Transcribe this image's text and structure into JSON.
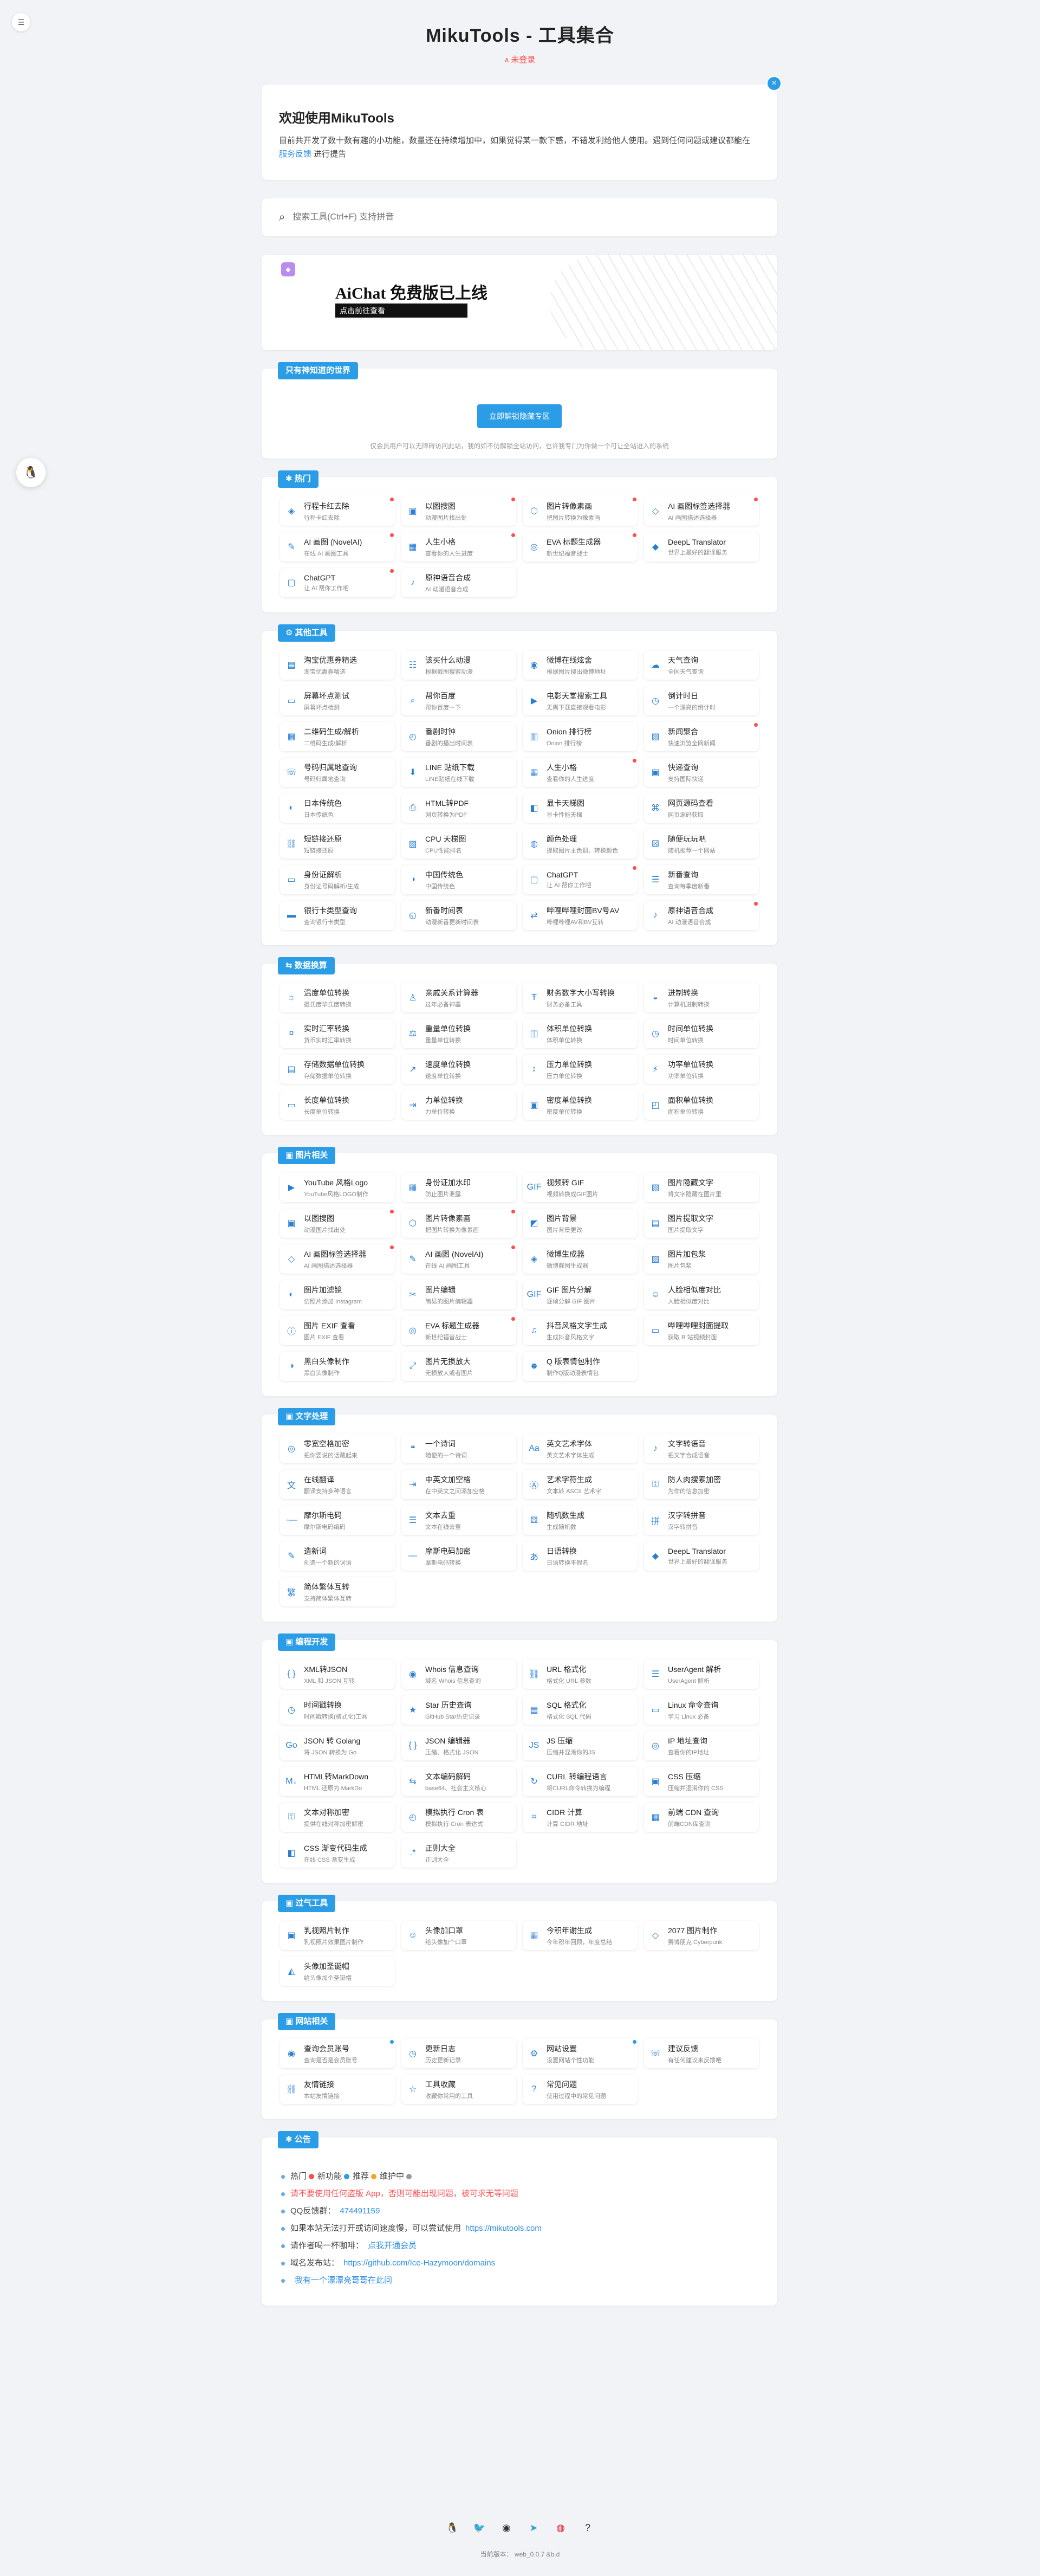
{
  "page": {
    "title": "MikuTools - 工具集合",
    "login": "ᴀ 未登录"
  },
  "welcome": {
    "heading": "欢迎使用MikuTools",
    "text": "目前共开发了数十数有趣的小功能，数量还在持续增加中，如果觉得某一款下感，不错发利给他人使用。遇到任何问题或建议都能在 ",
    "link": "服务反馈",
    "tail": " 进行提告"
  },
  "search": {
    "placeholder": "搜索工具(Ctrl+F) 支持拼音"
  },
  "banner": {
    "title": "AiChat 免费版已上线",
    "button": "点击前往查看"
  },
  "secret": {
    "title": "只有神知道的世界",
    "button": "立即解锁隐藏专区",
    "note": "仅会员用户可以无障碍访问此站，我的如不仿解锁全站访问，也许我专门为你做一个可让全站进入的系统"
  },
  "colors": {
    "accent": "#2b9de6",
    "hot": "#ff4d4f",
    "new": "#2b9de6",
    "rec": "#f5a623",
    "maint": "#999999"
  },
  "sections": [
    {
      "title": "✱ 热门",
      "tools": [
        {
          "name": "行程卡红去除",
          "desc": "行程卡红去除",
          "icon": "◈",
          "dot": "#ff4d4f"
        },
        {
          "name": "以图搜图",
          "desc": "动漫图片找出处",
          "icon": "▣",
          "dot": "#ff4d4f"
        },
        {
          "name": "图片转像素画",
          "desc": "把图片转换为像素画",
          "icon": "⬡",
          "dot": "#ff4d4f"
        },
        {
          "name": "AI 画图标签选择器",
          "desc": "AI 画图描述选择器",
          "icon": "◇",
          "dot": "#ff4d4f"
        },
        {
          "name": "AI 画图 (NovelAI)",
          "desc": "在线 AI 画图工具",
          "icon": "✎",
          "dot": "#ff4d4f"
        },
        {
          "name": "人生小格",
          "desc": "查看你的人生进度",
          "icon": "▦",
          "dot": "#ff4d4f"
        },
        {
          "name": "EVA 标题生成器",
          "desc": "新世纪福音战士",
          "icon": "◎",
          "dot": "#ff4d4f"
        },
        {
          "name": "DeepL Translator",
          "desc": "世界上最好的翻译服务",
          "icon": "◆",
          "dot": ""
        },
        {
          "name": "ChatGPT",
          "desc": "让 AI 帮你工作吧",
          "icon": "▢",
          "dot": "#ff4d4f"
        },
        {
          "name": "原神语音合成",
          "desc": "AI 动漫语音合成",
          "icon": "♪",
          "dot": ""
        }
      ]
    },
    {
      "title": "⚙ 其他工具",
      "tools": [
        {
          "name": "淘宝优惠券精选",
          "desc": "淘宝优惠券精选",
          "icon": "▤",
          "dot": ""
        },
        {
          "name": "该买什么动漫",
          "desc": "根据截图搜索动漫",
          "icon": "☷",
          "dot": ""
        },
        {
          "name": "微博在线炫舍",
          "desc": "根据图片搜出微博地址",
          "icon": "◉",
          "dot": ""
        },
        {
          "name": "天气查询",
          "desc": "全国天气查询",
          "icon": "☁",
          "dot": ""
        },
        {
          "name": "屏幕坏点测试",
          "desc": "屏幕坏点检测",
          "icon": "▭",
          "dot": ""
        },
        {
          "name": "帮你百度",
          "desc": "帮你百度一下",
          "icon": "⌕",
          "dot": ""
        },
        {
          "name": "电影天堂搜索工具",
          "desc": "无需下载直接观看电影",
          "icon": "▶",
          "dot": ""
        },
        {
          "name": "倒计时日",
          "desc": "一个漂亮的倒计时",
          "icon": "◷",
          "dot": ""
        },
        {
          "name": "二维码生成/解析",
          "desc": "二维码生成/解析",
          "icon": "▦",
          "dot": ""
        },
        {
          "name": "番剧时钟",
          "desc": "番剧的播出时间表",
          "icon": "◴",
          "dot": ""
        },
        {
          "name": "Onion 排行榜",
          "desc": "Onion 排行榜",
          "icon": "▥",
          "dot": ""
        },
        {
          "name": "新闻聚合",
          "desc": "快速浏览全网新闻",
          "icon": "▧",
          "dot": "#ff4d4f"
        },
        {
          "name": "号码归属地查询",
          "desc": "号码归属地查询",
          "icon": "☏",
          "dot": ""
        },
        {
          "name": "LINE 贴纸下载",
          "desc": "LINE贴纸在线下载",
          "icon": "⬇",
          "dot": ""
        },
        {
          "name": "人生小格",
          "desc": "查看你的人生进度",
          "icon": "▦",
          "dot": "#ff4d4f"
        },
        {
          "name": "快递查询",
          "desc": "支持国际快递",
          "icon": "▣",
          "dot": ""
        },
        {
          "name": "日本传统色",
          "desc": "日本传统色",
          "icon": "◐",
          "dot": ""
        },
        {
          "name": "HTML转PDF",
          "desc": "网页转换为PDF",
          "icon": "⎙",
          "dot": ""
        },
        {
          "name": "显卡天梯图",
          "desc": "显卡性能天梯",
          "icon": "◧",
          "dot": ""
        },
        {
          "name": "网页源码查看",
          "desc": "网页源码获取",
          "icon": "⌘",
          "dot": ""
        },
        {
          "name": "短链接还原",
          "desc": "短链接还原",
          "icon": "⛓",
          "dot": ""
        },
        {
          "name": "CPU 天梯图",
          "desc": "CPU性能排名",
          "icon": "▨",
          "dot": ""
        },
        {
          "name": "颜色处理",
          "desc": "提取图片主色调、转换颜色",
          "icon": "◍",
          "dot": ""
        },
        {
          "name": "随便玩玩吧",
          "desc": "随机推荐一个网站",
          "icon": "⚄",
          "dot": ""
        },
        {
          "name": "身份证解析",
          "desc": "身份证号码解析/生成",
          "icon": "▭",
          "dot": ""
        },
        {
          "name": "中国传统色",
          "desc": "中国传统色",
          "icon": "◑",
          "dot": ""
        },
        {
          "name": "ChatGPT",
          "desc": "让 AI 帮你工作吧",
          "icon": "▢",
          "dot": "#ff4d4f"
        },
        {
          "name": "新番查询",
          "desc": "查询每季度新番",
          "icon": "☰",
          "dot": ""
        },
        {
          "name": "银行卡类型查询",
          "desc": "查询银行卡类型",
          "icon": "▬",
          "dot": ""
        },
        {
          "name": "新番时间表",
          "desc": "动漫新番更新时间表",
          "icon": "◵",
          "dot": ""
        },
        {
          "name": "哔哩哔哩封面BV号AV",
          "desc": "哔哩哔哩AV和BV互转",
          "icon": "⇄",
          "dot": ""
        },
        {
          "name": "原神语音合成",
          "desc": "AI 动漫语音合成",
          "icon": "♪",
          "dot": "#ff4d4f"
        }
      ]
    },
    {
      "title": "⇆ 数据换算",
      "tools": [
        {
          "name": "温度单位转换",
          "desc": "摄氏度华氏度转换",
          "icon": "☼",
          "dot": ""
        },
        {
          "name": "亲戚关系计算器",
          "desc": "过年必备神器",
          "icon": "♙",
          "dot": ""
        },
        {
          "name": "财务数字大小写转换",
          "desc": "财务必备工具",
          "icon": "Ŧ",
          "dot": ""
        },
        {
          "name": "进制转换",
          "desc": "计算机进制转换",
          "icon": "◒",
          "dot": ""
        },
        {
          "name": "实时汇率转换",
          "desc": "货币实时汇率转换",
          "icon": "¤",
          "dot": ""
        },
        {
          "name": "重量单位转换",
          "desc": "重量单位转换",
          "icon": "⚖",
          "dot": ""
        },
        {
          "name": "体积单位转换",
          "desc": "体积单位转换",
          "icon": "◫",
          "dot": ""
        },
        {
          "name": "时间单位转换",
          "desc": "时间单位转换",
          "icon": "◷",
          "dot": ""
        },
        {
          "name": "存储数据单位转换",
          "desc": "存储数据单位转换",
          "icon": "▤",
          "dot": ""
        },
        {
          "name": "速度单位转换",
          "desc": "速度单位转换",
          "icon": "↗",
          "dot": ""
        },
        {
          "name": "压力单位转换",
          "desc": "压力单位转换",
          "icon": "↕",
          "dot": ""
        },
        {
          "name": "功率单位转换",
          "desc": "功率单位转换",
          "icon": "⚡",
          "dot": ""
        },
        {
          "name": "长度单位转换",
          "desc": "长度单位转换",
          "icon": "▭",
          "dot": ""
        },
        {
          "name": "力单位转换",
          "desc": "力单位转换",
          "icon": "⇥",
          "dot": ""
        },
        {
          "name": "密度单位转换",
          "desc": "密度单位转换",
          "icon": "▣",
          "dot": ""
        },
        {
          "name": "面积单位转换",
          "desc": "面积单位转换",
          "icon": "◰",
          "dot": ""
        }
      ]
    },
    {
      "title": "▣ 图片相关",
      "tools": [
        {
          "name": "YouTube 风格Logo",
          "desc": "YouTube风格LOGO制作",
          "icon": "▶",
          "dot": ""
        },
        {
          "name": "身份证加水印",
          "desc": "防止图片泄露",
          "icon": "▦",
          "dot": ""
        },
        {
          "name": "视频转 GIF",
          "desc": "视频转换成GIF图片",
          "icon": "GIF",
          "dot": ""
        },
        {
          "name": "图片隐藏文字",
          "desc": "将文字隐藏在图片里",
          "icon": "▧",
          "dot": ""
        },
        {
          "name": "以图搜图",
          "desc": "动漫图片找出处",
          "icon": "▣",
          "dot": "#ff4d4f"
        },
        {
          "name": "图片转像素画",
          "desc": "把图片转换为像素画",
          "icon": "⬡",
          "dot": "#ff4d4f"
        },
        {
          "name": "图片背景",
          "desc": "图片背景更改",
          "icon": "◩",
          "dot": ""
        },
        {
          "name": "图片提取文字",
          "desc": "图片提取文字",
          "icon": "▤",
          "dot": ""
        },
        {
          "name": "AI 画图标签选择器",
          "desc": "AI 画图描述选择器",
          "icon": "◇",
          "dot": "#ff4d4f"
        },
        {
          "name": "AI 画图 (NovelAI)",
          "desc": "在线 AI 画图工具",
          "icon": "✎",
          "dot": "#ff4d4f"
        },
        {
          "name": "微博生成器",
          "desc": "微博截图生成器",
          "icon": "◈",
          "dot": ""
        },
        {
          "name": "图片加包浆",
          "desc": "图片包浆",
          "icon": "▨",
          "dot": ""
        },
        {
          "name": "图片加滤镜",
          "desc": "仿照片添加 Instagram",
          "icon": "◐",
          "dot": ""
        },
        {
          "name": "图片编辑",
          "desc": "简易的图片编辑器",
          "icon": "✂",
          "dot": ""
        },
        {
          "name": "GIF 图片分解",
          "desc": "逐帧分解 GIF 图片",
          "icon": "GIF",
          "dot": ""
        },
        {
          "name": "人脸相似度对比",
          "desc": "人脸相似度对比",
          "icon": "☺",
          "dot": ""
        },
        {
          "name": "图片 EXIF 查看",
          "desc": "图片 EXIF 查看",
          "icon": "ⓘ",
          "dot": ""
        },
        {
          "name": "EVA 标题生成器",
          "desc": "新世纪福音战士",
          "icon": "◎",
          "dot": "#ff4d4f"
        },
        {
          "name": "抖音风格文字生成",
          "desc": "生成抖音风格文字",
          "icon": "♫",
          "dot": ""
        },
        {
          "name": "哔哩哔哩封面提取",
          "desc": "获取 B 站视频封面",
          "icon": "▭",
          "dot": ""
        },
        {
          "name": "黑白头像制作",
          "desc": "黑白头像制作",
          "icon": "◑",
          "dot": ""
        },
        {
          "name": "图片无损放大",
          "desc": "无损放大或者图片",
          "icon": "⤢",
          "dot": ""
        },
        {
          "name": "Q 版表情包制作",
          "desc": "制作Q版动漫表情包",
          "icon": "☻",
          "dot": ""
        }
      ]
    },
    {
      "title": "▣ 文字处理",
      "tools": [
        {
          "name": "零宽空格加密",
          "desc": "把你要说的话藏起来",
          "icon": "◎",
          "dot": ""
        },
        {
          "name": "一个诗词",
          "desc": "随便的一个诗词",
          "icon": "❝",
          "dot": ""
        },
        {
          "name": "英文艺术字体",
          "desc": "英文艺术字体生成",
          "icon": "Aa",
          "dot": ""
        },
        {
          "name": "文字转语音",
          "desc": "把文字合成语音",
          "icon": "♪",
          "dot": ""
        },
        {
          "name": "在线翻译",
          "desc": "翻译支持多种语言",
          "icon": "文",
          "dot": ""
        },
        {
          "name": "中英文加空格",
          "desc": "在中英文之间添加空格",
          "icon": "⇥",
          "dot": ""
        },
        {
          "name": "艺术字符生成",
          "desc": "文本转 ASCII 艺术字",
          "icon": "Ⓐ",
          "dot": ""
        },
        {
          "name": "防人肉搜索加密",
          "desc": "为你的信息加密",
          "icon": "⚿",
          "dot": ""
        },
        {
          "name": "摩尔斯电码",
          "desc": "摩尔斯电码编码",
          "icon": "·—",
          "dot": ""
        },
        {
          "name": "文本去重",
          "desc": "文本在线去重",
          "icon": "☰",
          "dot": ""
        },
        {
          "name": "随机数生成",
          "desc": "生成随机数",
          "icon": "⚄",
          "dot": ""
        },
        {
          "name": "汉字转拼音",
          "desc": "汉字转拼音",
          "icon": "拼",
          "dot": ""
        },
        {
          "name": "造新词",
          "desc": "创造一个新的词语",
          "icon": "✎",
          "dot": ""
        },
        {
          "name": "摩斯电码加密",
          "desc": "摩斯电码转换",
          "icon": "—",
          "dot": ""
        },
        {
          "name": "日语转换",
          "desc": "日语转换平假名",
          "icon": "あ",
          "dot": ""
        },
        {
          "name": "DeepL Translator",
          "desc": "世界上最好的翻译服务",
          "icon": "◆",
          "dot": ""
        },
        {
          "name": "简体繁体互转",
          "desc": "支持简体繁体互转",
          "icon": "繁",
          "dot": ""
        }
      ]
    },
    {
      "title": "▣ 编程开发",
      "tools": [
        {
          "name": "XML转JSON",
          "desc": "XML 和 JSON 互转",
          "icon": "{ }",
          "dot": ""
        },
        {
          "name": "Whois 信息查询",
          "desc": "域名 Whois 信息查询",
          "icon": "◉",
          "dot": ""
        },
        {
          "name": "URL 格式化",
          "desc": "格式化 URL 参数",
          "icon": "⛓",
          "dot": ""
        },
        {
          "name": "UserAgent 解析",
          "desc": "UserAgent 解析",
          "icon": "☰",
          "dot": ""
        },
        {
          "name": "时间戳转换",
          "desc": "时间戳转换(格式化)工具",
          "icon": "◷",
          "dot": ""
        },
        {
          "name": "Star 历史查询",
          "desc": "GitHub Star历史记录",
          "icon": "★",
          "dot": ""
        },
        {
          "name": "SQL 格式化",
          "desc": "格式化 SQL 代码",
          "icon": "▤",
          "dot": ""
        },
        {
          "name": "Linux 命令查询",
          "desc": "学习 Linux 必备",
          "icon": "▭",
          "dot": ""
        },
        {
          "name": "JSON 转 Golang",
          "desc": "将 JSON 转换为 Go",
          "icon": "Go",
          "dot": ""
        },
        {
          "name": "JSON 编辑器",
          "desc": "压缩、格式化 JSON",
          "icon": "{ }",
          "dot": ""
        },
        {
          "name": "JS 压缩",
          "desc": "压缩并混淆你的JS",
          "icon": "JS",
          "dot": ""
        },
        {
          "name": "IP 地址查询",
          "desc": "查看你的IP地址",
          "icon": "◎",
          "dot": ""
        },
        {
          "name": "HTML转MarkDown",
          "desc": "HTML 还原为 MarkDo",
          "icon": "M↓",
          "dot": ""
        },
        {
          "name": "文本编码解码",
          "desc": "base64、社会主义核心",
          "icon": "⇆",
          "dot": ""
        },
        {
          "name": "CURL 转编程语言",
          "desc": "将CURL命令转换为编程",
          "icon": "↻",
          "dot": ""
        },
        {
          "name": "CSS 压缩",
          "desc": "压缩并混淆你的 CSS",
          "icon": "▣",
          "dot": ""
        },
        {
          "name": "文本对称加密",
          "desc": "提供在线对称加密解密",
          "icon": "⚿",
          "dot": ""
        },
        {
          "name": "模拟执行 Cron 表",
          "desc": "模拟执行 Cron 表达式",
          "icon": "◴",
          "dot": ""
        },
        {
          "name": "CIDR 计算",
          "desc": "计算 CIDR 地址",
          "icon": "⌗",
          "dot": ""
        },
        {
          "name": "前端 CDN 查询",
          "desc": "前端CDN库查询",
          "icon": "▦",
          "dot": ""
        },
        {
          "name": "CSS 渐变代码生成",
          "desc": "在线 CSS 渐变生成",
          "icon": "◧",
          "dot": ""
        },
        {
          "name": "正则大全",
          "desc": "正则大全",
          "icon": ".*",
          "dot": ""
        }
      ]
    },
    {
      "title": "▣ 过气工具",
      "tools": [
        {
          "name": "乳视照片制作",
          "desc": "乳视照片效果图片制作",
          "icon": "▣",
          "dot": ""
        },
        {
          "name": "头像加口罩",
          "desc": "给头像加个口罩",
          "icon": "☺",
          "dot": ""
        },
        {
          "name": "今积年谢生成",
          "desc": "今年积年回顾，年度总结",
          "icon": "▦",
          "dot": ""
        },
        {
          "name": "2077 图片制作",
          "desc": "赛博朋克 Cyberpunk",
          "icon": "◇",
          "dot": ""
        },
        {
          "name": "头像加圣诞帽",
          "desc": "给头像加个圣诞帽",
          "icon": "◭",
          "dot": ""
        }
      ]
    },
    {
      "title": "▣ 网站相关",
      "tools": [
        {
          "name": "查询会员账号",
          "desc": "查询是否是会员账号",
          "icon": "◉",
          "dot": "#2b9de6"
        },
        {
          "name": "更新日志",
          "desc": "历史更新记录",
          "icon": "◷",
          "dot": ""
        },
        {
          "name": "网站设置",
          "desc": "设置网站个性功能",
          "icon": "⚙",
          "dot": "#2b9de6"
        },
        {
          "name": "建议反馈",
          "desc": "有任何建议来反馈吧",
          "icon": "☏",
          "dot": ""
        },
        {
          "name": "友情链接",
          "desc": "本站友情链接",
          "icon": "⛓",
          "dot": ""
        },
        {
          "name": "工具收藏",
          "desc": "收藏你常用的工具",
          "icon": "☆",
          "dot": ""
        },
        {
          "name": "常见问题",
          "desc": "使用过程中的常见问题",
          "icon": "?",
          "dot": ""
        }
      ]
    }
  ],
  "notice": {
    "title": "✱ 公告",
    "legend": [
      "热门",
      "新功能",
      "推荐",
      "维护中"
    ],
    "lines": [
      {
        "text": "请不要使用任何盗版 App，否则可能出现问题，被可求无等问题",
        "link": "",
        "color": "#ff4d4f"
      },
      {
        "text": "QQ反馈群：",
        "link": "474491159",
        "color": "#444"
      },
      {
        "text": "如果本站无法打开或访问速度慢，可以尝试使用",
        "link": "https://mikutools.com",
        "color": "#444"
      },
      {
        "text": "请作者喝一杯咖啡：",
        "link": "点我开通会员",
        "color": "#444"
      },
      {
        "text": "域名发布站：",
        "link": "https://github.com/Ice-Hazymoon/domains",
        "color": "#444"
      },
      {
        "text": "",
        "link": "我有一个漂漂亮哥哥在此问",
        "color": "#444"
      }
    ]
  },
  "footer": {
    "icons": [
      "penguin-icon",
      "twitter-icon",
      "github-icon",
      "telegram-icon",
      "weibo-icon",
      "help-icon"
    ],
    "version": "当前版本： web_0.0.7 &b.d"
  }
}
